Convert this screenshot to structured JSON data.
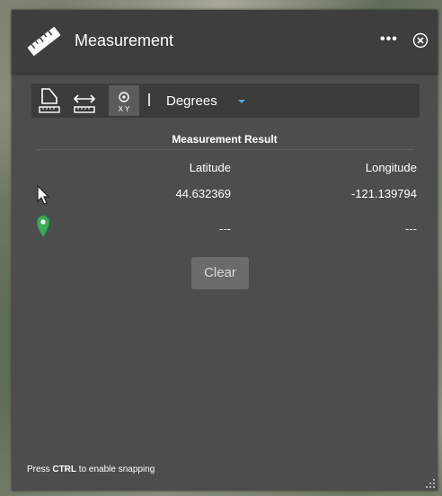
{
  "window": {
    "title": "Measurement",
    "more_label": "•••"
  },
  "toolbar": {
    "tools": [
      {
        "name": "area",
        "icon": "area-ruler-icon",
        "active": false
      },
      {
        "name": "distance",
        "icon": "distance-ruler-icon",
        "active": false
      },
      {
        "name": "location",
        "icon": "location-xy-icon",
        "active": true,
        "icon_text": "X Y"
      }
    ],
    "unit_label": "Degrees"
  },
  "result": {
    "title": "Measurement Result",
    "columns": [
      "Latitude",
      "Longitude"
    ],
    "rows": [
      {
        "icon": "cursor-arrow-icon",
        "latitude": "44.632369",
        "longitude": "-121.139794"
      },
      {
        "icon": "green-marker-icon",
        "latitude": "---",
        "longitude": "---"
      }
    ]
  },
  "actions": {
    "clear_label": "Clear"
  },
  "hint": {
    "prefix": "Press",
    "key": "CTRL",
    "suffix": "to enable snapping"
  },
  "colors": {
    "panel": "#4d4d4d",
    "titlebar": "#3e3e3e",
    "toolbar": "#3b3b3b",
    "accent": "#5aa7d8",
    "marker": "#3fa858"
  }
}
